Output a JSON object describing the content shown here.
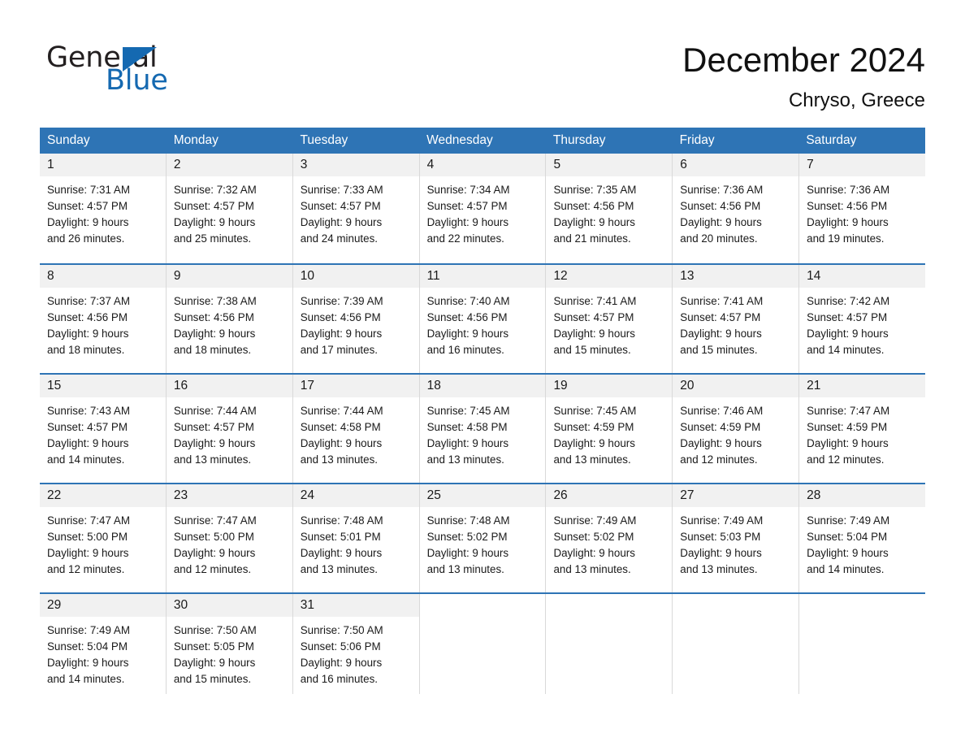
{
  "logo": {
    "word1": "General",
    "word2": "Blue",
    "triangle_color": "#1569b1",
    "icon": "triangle-icon"
  },
  "header": {
    "title": "December 2024",
    "subtitle": "Chryso, Greece",
    "accent_color": "#2e74b5",
    "band_color": "#f1f1f1"
  },
  "calendar": {
    "weekdays": [
      "Sunday",
      "Monday",
      "Tuesday",
      "Wednesday",
      "Thursday",
      "Friday",
      "Saturday"
    ],
    "weeks": [
      [
        {
          "day": "1",
          "sunrise": "Sunrise: 7:31 AM",
          "sunset": "Sunset: 4:57 PM",
          "daylight1": "Daylight: 9 hours",
          "daylight2": "and 26 minutes."
        },
        {
          "day": "2",
          "sunrise": "Sunrise: 7:32 AM",
          "sunset": "Sunset: 4:57 PM",
          "daylight1": "Daylight: 9 hours",
          "daylight2": "and 25 minutes."
        },
        {
          "day": "3",
          "sunrise": "Sunrise: 7:33 AM",
          "sunset": "Sunset: 4:57 PM",
          "daylight1": "Daylight: 9 hours",
          "daylight2": "and 24 minutes."
        },
        {
          "day": "4",
          "sunrise": "Sunrise: 7:34 AM",
          "sunset": "Sunset: 4:57 PM",
          "daylight1": "Daylight: 9 hours",
          "daylight2": "and 22 minutes."
        },
        {
          "day": "5",
          "sunrise": "Sunrise: 7:35 AM",
          "sunset": "Sunset: 4:56 PM",
          "daylight1": "Daylight: 9 hours",
          "daylight2": "and 21 minutes."
        },
        {
          "day": "6",
          "sunrise": "Sunrise: 7:36 AM",
          "sunset": "Sunset: 4:56 PM",
          "daylight1": "Daylight: 9 hours",
          "daylight2": "and 20 minutes."
        },
        {
          "day": "7",
          "sunrise": "Sunrise: 7:36 AM",
          "sunset": "Sunset: 4:56 PM",
          "daylight1": "Daylight: 9 hours",
          "daylight2": "and 19 minutes."
        }
      ],
      [
        {
          "day": "8",
          "sunrise": "Sunrise: 7:37 AM",
          "sunset": "Sunset: 4:56 PM",
          "daylight1": "Daylight: 9 hours",
          "daylight2": "and 18 minutes."
        },
        {
          "day": "9",
          "sunrise": "Sunrise: 7:38 AM",
          "sunset": "Sunset: 4:56 PM",
          "daylight1": "Daylight: 9 hours",
          "daylight2": "and 18 minutes."
        },
        {
          "day": "10",
          "sunrise": "Sunrise: 7:39 AM",
          "sunset": "Sunset: 4:56 PM",
          "daylight1": "Daylight: 9 hours",
          "daylight2": "and 17 minutes."
        },
        {
          "day": "11",
          "sunrise": "Sunrise: 7:40 AM",
          "sunset": "Sunset: 4:56 PM",
          "daylight1": "Daylight: 9 hours",
          "daylight2": "and 16 minutes."
        },
        {
          "day": "12",
          "sunrise": "Sunrise: 7:41 AM",
          "sunset": "Sunset: 4:57 PM",
          "daylight1": "Daylight: 9 hours",
          "daylight2": "and 15 minutes."
        },
        {
          "day": "13",
          "sunrise": "Sunrise: 7:41 AM",
          "sunset": "Sunset: 4:57 PM",
          "daylight1": "Daylight: 9 hours",
          "daylight2": "and 15 minutes."
        },
        {
          "day": "14",
          "sunrise": "Sunrise: 7:42 AM",
          "sunset": "Sunset: 4:57 PM",
          "daylight1": "Daylight: 9 hours",
          "daylight2": "and 14 minutes."
        }
      ],
      [
        {
          "day": "15",
          "sunrise": "Sunrise: 7:43 AM",
          "sunset": "Sunset: 4:57 PM",
          "daylight1": "Daylight: 9 hours",
          "daylight2": "and 14 minutes."
        },
        {
          "day": "16",
          "sunrise": "Sunrise: 7:44 AM",
          "sunset": "Sunset: 4:57 PM",
          "daylight1": "Daylight: 9 hours",
          "daylight2": "and 13 minutes."
        },
        {
          "day": "17",
          "sunrise": "Sunrise: 7:44 AM",
          "sunset": "Sunset: 4:58 PM",
          "daylight1": "Daylight: 9 hours",
          "daylight2": "and 13 minutes."
        },
        {
          "day": "18",
          "sunrise": "Sunrise: 7:45 AM",
          "sunset": "Sunset: 4:58 PM",
          "daylight1": "Daylight: 9 hours",
          "daylight2": "and 13 minutes."
        },
        {
          "day": "19",
          "sunrise": "Sunrise: 7:45 AM",
          "sunset": "Sunset: 4:59 PM",
          "daylight1": "Daylight: 9 hours",
          "daylight2": "and 13 minutes."
        },
        {
          "day": "20",
          "sunrise": "Sunrise: 7:46 AM",
          "sunset": "Sunset: 4:59 PM",
          "daylight1": "Daylight: 9 hours",
          "daylight2": "and 12 minutes."
        },
        {
          "day": "21",
          "sunrise": "Sunrise: 7:47 AM",
          "sunset": "Sunset: 4:59 PM",
          "daylight1": "Daylight: 9 hours",
          "daylight2": "and 12 minutes."
        }
      ],
      [
        {
          "day": "22",
          "sunrise": "Sunrise: 7:47 AM",
          "sunset": "Sunset: 5:00 PM",
          "daylight1": "Daylight: 9 hours",
          "daylight2": "and 12 minutes."
        },
        {
          "day": "23",
          "sunrise": "Sunrise: 7:47 AM",
          "sunset": "Sunset: 5:00 PM",
          "daylight1": "Daylight: 9 hours",
          "daylight2": "and 12 minutes."
        },
        {
          "day": "24",
          "sunrise": "Sunrise: 7:48 AM",
          "sunset": "Sunset: 5:01 PM",
          "daylight1": "Daylight: 9 hours",
          "daylight2": "and 13 minutes."
        },
        {
          "day": "25",
          "sunrise": "Sunrise: 7:48 AM",
          "sunset": "Sunset: 5:02 PM",
          "daylight1": "Daylight: 9 hours",
          "daylight2": "and 13 minutes."
        },
        {
          "day": "26",
          "sunrise": "Sunrise: 7:49 AM",
          "sunset": "Sunset: 5:02 PM",
          "daylight1": "Daylight: 9 hours",
          "daylight2": "and 13 minutes."
        },
        {
          "day": "27",
          "sunrise": "Sunrise: 7:49 AM",
          "sunset": "Sunset: 5:03 PM",
          "daylight1": "Daylight: 9 hours",
          "daylight2": "and 13 minutes."
        },
        {
          "day": "28",
          "sunrise": "Sunrise: 7:49 AM",
          "sunset": "Sunset: 5:04 PM",
          "daylight1": "Daylight: 9 hours",
          "daylight2": "and 14 minutes."
        }
      ],
      [
        {
          "day": "29",
          "sunrise": "Sunrise: 7:49 AM",
          "sunset": "Sunset: 5:04 PM",
          "daylight1": "Daylight: 9 hours",
          "daylight2": "and 14 minutes."
        },
        {
          "day": "30",
          "sunrise": "Sunrise: 7:50 AM",
          "sunset": "Sunset: 5:05 PM",
          "daylight1": "Daylight: 9 hours",
          "daylight2": "and 15 minutes."
        },
        {
          "day": "31",
          "sunrise": "Sunrise: 7:50 AM",
          "sunset": "Sunset: 5:06 PM",
          "daylight1": "Daylight: 9 hours",
          "daylight2": "and 16 minutes."
        },
        {
          "day": "",
          "sunrise": "",
          "sunset": "",
          "daylight1": "",
          "daylight2": ""
        },
        {
          "day": "",
          "sunrise": "",
          "sunset": "",
          "daylight1": "",
          "daylight2": ""
        },
        {
          "day": "",
          "sunrise": "",
          "sunset": "",
          "daylight1": "",
          "daylight2": ""
        },
        {
          "day": "",
          "sunrise": "",
          "sunset": "",
          "daylight1": "",
          "daylight2": ""
        }
      ]
    ]
  }
}
